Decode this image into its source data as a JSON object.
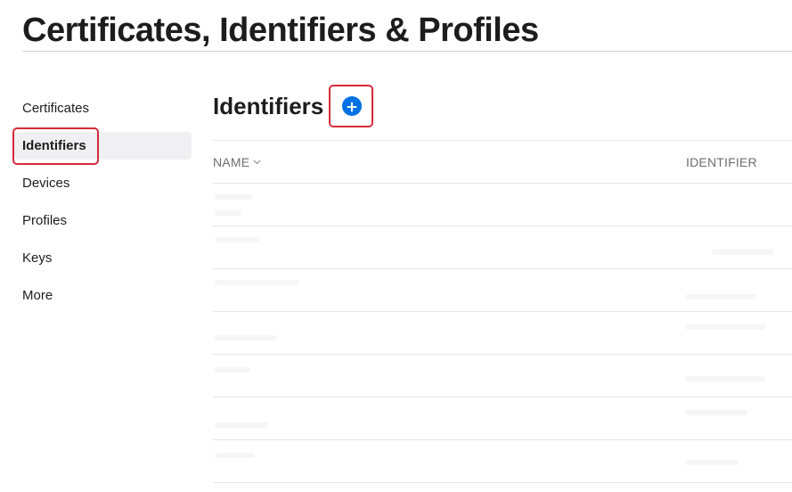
{
  "page_title": "Certificates, Identifiers & Profiles",
  "sidebar": {
    "items": [
      {
        "label": "Certificates"
      },
      {
        "label": "Identifiers"
      },
      {
        "label": "Devices"
      },
      {
        "label": "Profiles"
      },
      {
        "label": "Keys"
      },
      {
        "label": "More"
      }
    ]
  },
  "main": {
    "section_title": "Identifiers",
    "add_icon_glyph": "+",
    "table": {
      "columns": [
        {
          "label": "NAME",
          "sort_icon": "chevron-down-icon"
        },
        {
          "label": "IDENTIFIER"
        }
      ]
    }
  },
  "colors": {
    "accent": "#0071e3",
    "highlight": "#d42b3a",
    "active_item_bg": "#f0f0f2"
  }
}
